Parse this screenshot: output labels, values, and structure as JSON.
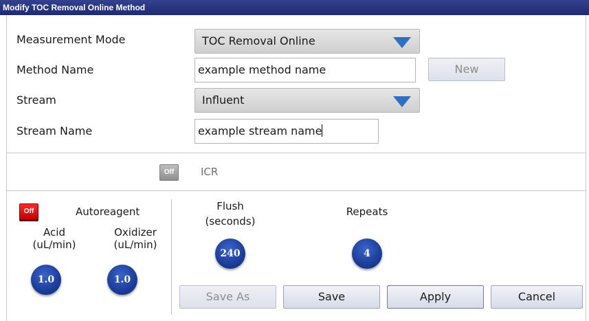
{
  "window": {
    "title": "Modify TOC Removal Online Method"
  },
  "form": {
    "measurement_mode": {
      "label": "Measurement Mode",
      "value": "TOC Removal Online"
    },
    "method_name": {
      "label": "Method Name",
      "value": "example method name",
      "new_button": "New"
    },
    "stream": {
      "label": "Stream",
      "value": "Influent"
    },
    "stream_name": {
      "label": "Stream Name",
      "value": "example stream name"
    }
  },
  "icr": {
    "toggle_state": "Off",
    "label": "ICR"
  },
  "autoreagent": {
    "toggle_state": "Off",
    "label": "Autoreagent",
    "acid": {
      "label_line1": "Acid",
      "label_line2": "(uL/min)",
      "value": "1.0"
    },
    "oxidizer": {
      "label_line1": "Oxidizer",
      "label_line2": "(uL/min)",
      "value": "1.0"
    }
  },
  "flush": {
    "label_line1": "Flush",
    "label_line2": "(seconds)",
    "value": "240"
  },
  "repeats": {
    "label": "Repeats",
    "value": "4"
  },
  "buttons": {
    "save_as": "Save As",
    "save": "Save",
    "apply": "Apply",
    "cancel": "Cancel"
  },
  "colors": {
    "title_bar": "#1f2a6e",
    "dropdown_arrow": "#2f6fc4",
    "knob": "#1b3d9a",
    "toggle_off_red": "#e00000"
  },
  "icons": {
    "dropdown": "triangle-down",
    "knob": "circular-dial"
  }
}
